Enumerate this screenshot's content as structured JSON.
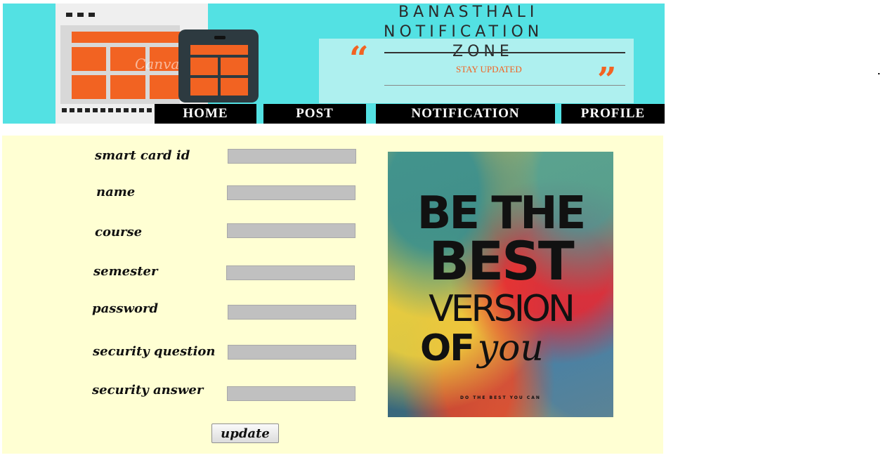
{
  "header": {
    "title_line1": "BANASTHALI",
    "title_line2": "NOTIFICATION",
    "title_line3": "ZONE",
    "tagline": "STAY UPDATED",
    "quote_open": "“",
    "quote_close": "”",
    "watermark": "Canva"
  },
  "nav": {
    "home": "HOME",
    "post": "POST",
    "notification": "NOTIFICATION",
    "profile": "PROFILE"
  },
  "form": {
    "fields": [
      {
        "label": "smart card id",
        "value": ""
      },
      {
        "label": "name",
        "value": ""
      },
      {
        "label": "course",
        "value": ""
      },
      {
        "label": "semester",
        "value": ""
      },
      {
        "label": "password",
        "value": ""
      },
      {
        "label": "security question",
        "value": ""
      },
      {
        "label": "security answer",
        "value": ""
      }
    ],
    "submit_label": "update"
  },
  "poster": {
    "line1": "BE THE",
    "line2": "BEST",
    "line3": "VERSION",
    "of": "OF",
    "you": "you",
    "footer": "DO THE BEST YOU CAN"
  },
  "colors": {
    "banner": "#53e1e3",
    "accent": "#f26322",
    "panel": "#ffffd3",
    "input": "#c0c0c0",
    "nav": "#000000"
  }
}
